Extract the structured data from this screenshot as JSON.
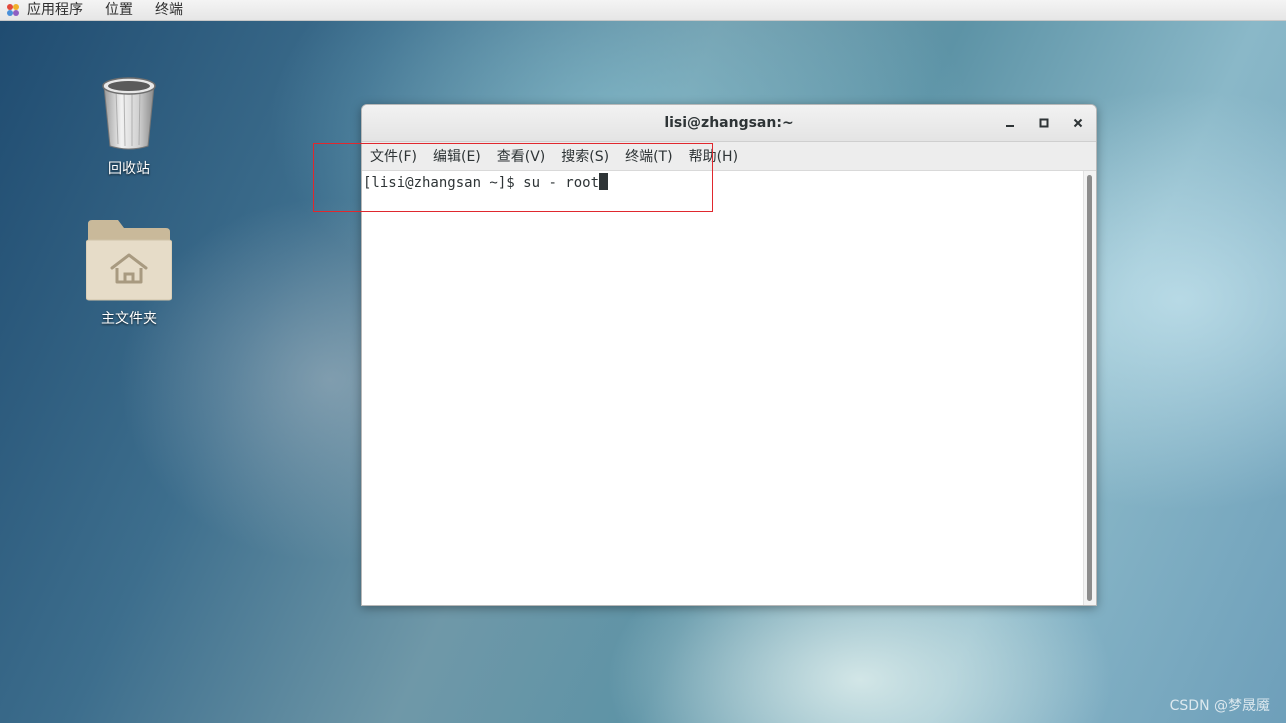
{
  "top_panel": {
    "menus": [
      "应用程序",
      "位置",
      "终端"
    ]
  },
  "desktop": {
    "icons": [
      {
        "label": "回收站",
        "icon": "trash-icon"
      },
      {
        "label": "主文件夹",
        "icon": "home-folder-icon"
      }
    ]
  },
  "terminal_window": {
    "title": "lisi@zhangsan:~",
    "menu": [
      "文件(F)",
      "编辑(E)",
      "查看(V)",
      "搜索(S)",
      "终端(T)",
      "帮助(H)"
    ],
    "prompt": "[lisi@zhangsan ~]$ ",
    "command": "su - root"
  },
  "highlight_color": "#e0282e",
  "watermark": "CSDN @梦晟魇"
}
